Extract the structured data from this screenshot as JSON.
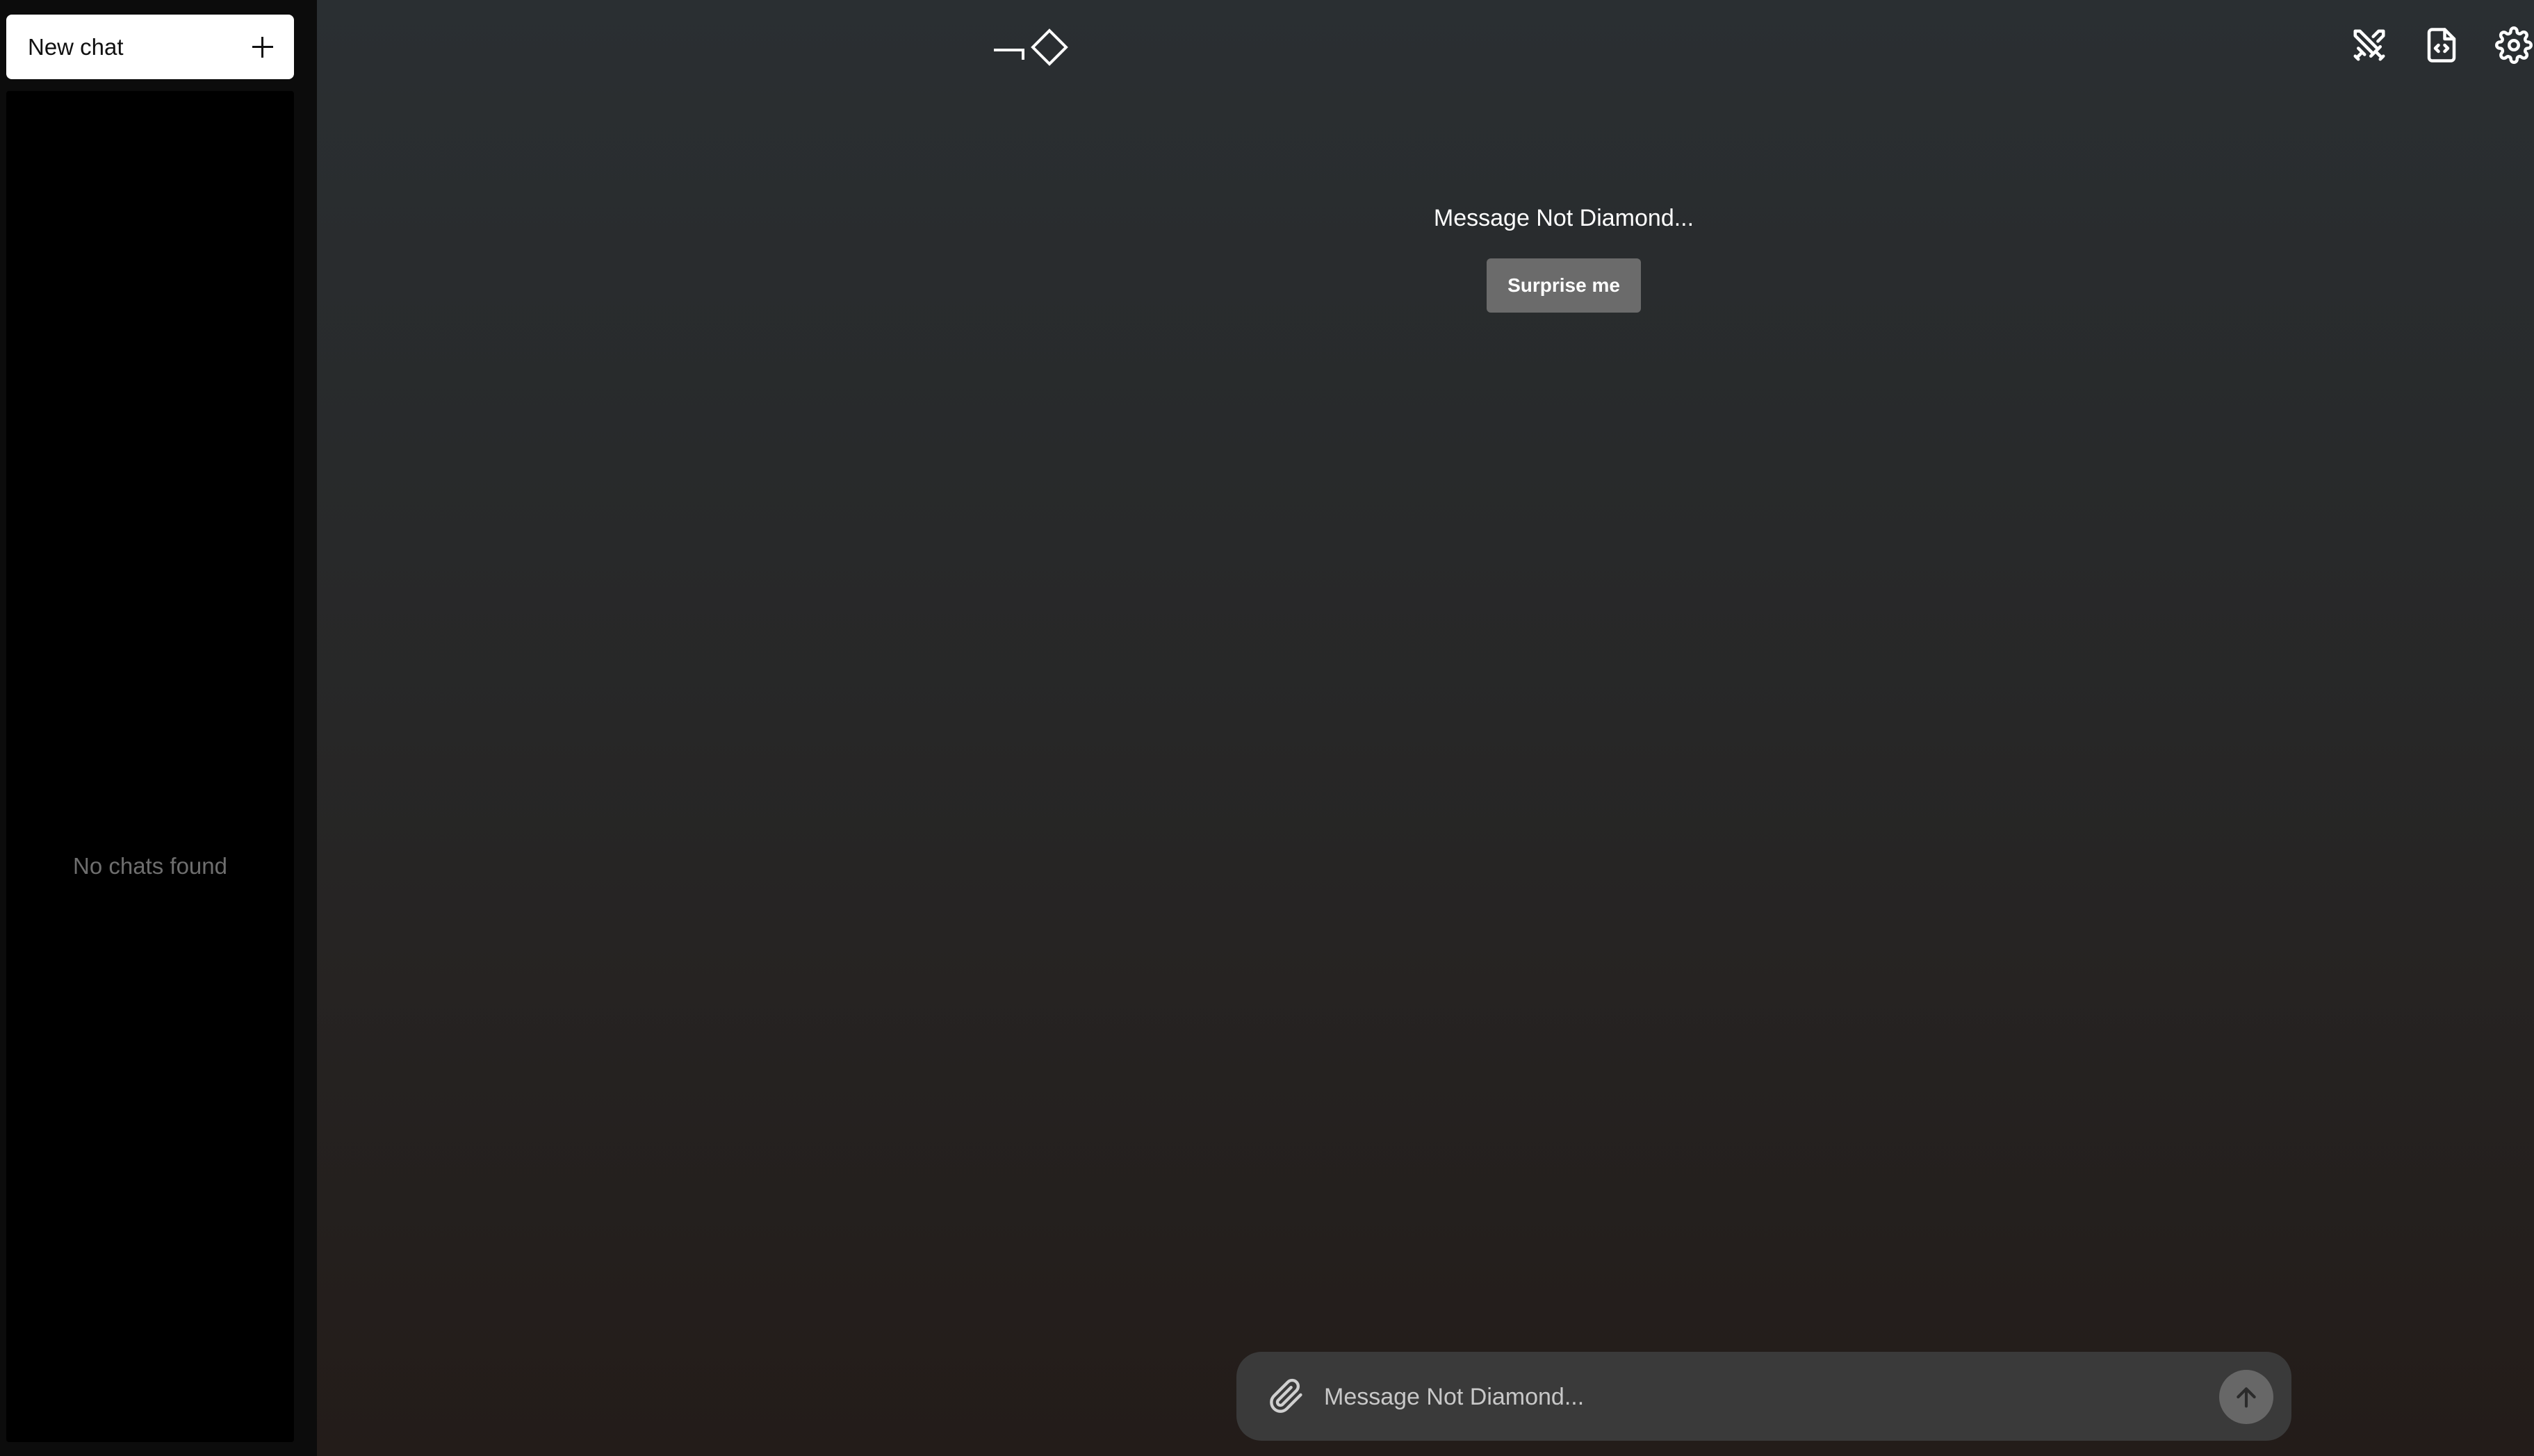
{
  "sidebar": {
    "new_chat_label": "New chat",
    "empty_text": "No chats found"
  },
  "header": {
    "icons": [
      "swords-icon",
      "code-file-icon",
      "gear-icon"
    ]
  },
  "main": {
    "prompt_title": "Message Not Diamond...",
    "surprise_label": "Surprise me"
  },
  "composer": {
    "placeholder": "Message Not Diamond..."
  },
  "colors": {
    "sidebar_bg": "#000000",
    "composer_bg": "#3a3a3a",
    "surprise_bg": "#6b6b6b"
  }
}
